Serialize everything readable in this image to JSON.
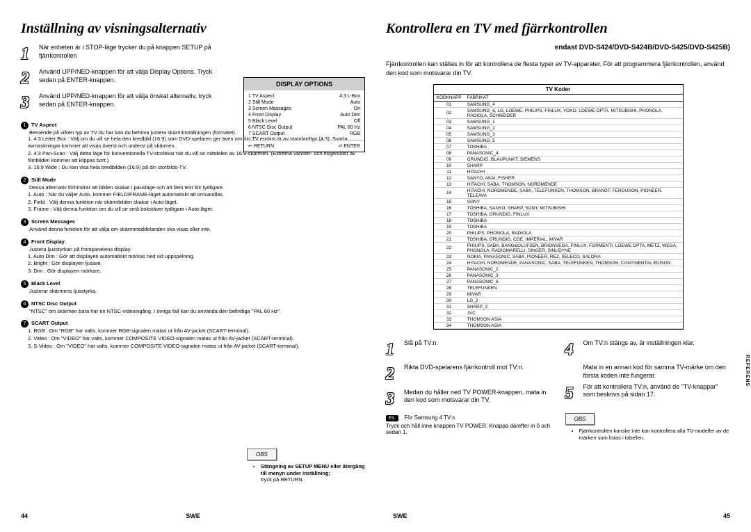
{
  "left": {
    "title": "Inställning av visningsalternativ",
    "steps": [
      {
        "n": "1",
        "text": "När enheten är i STOP-läge trycker du på knappen SETUP på fjärrkontrollen"
      },
      {
        "n": "2",
        "text": "Använd UPP/NED-knappen för att välja Display Options. Tryck sedan på ENTER-knappen."
      },
      {
        "n": "3",
        "text": "Använd UPP/NED-knappen för att välja önskat alternativ, tryck sedan på ENTER-knappen."
      }
    ],
    "panel": {
      "title": "DISPLAY OPTIONS",
      "rows": [
        {
          "l": "1 TV Aspect",
          "r": "4:3 L-Box"
        },
        {
          "l": "2 Still Mode",
          "r": "Auto"
        },
        {
          "l": "3 Screen Massages",
          "r": "On"
        },
        {
          "l": "4 Front Display",
          "r": "Auto Dim"
        },
        {
          "l": "5 Black Level",
          "r": "Off"
        },
        {
          "l": "6 NTSC Disc Output",
          "r": "PAL 60 Hz"
        },
        {
          "l": "7 SCART Output",
          "r": "RGB"
        }
      ],
      "return": "RETURN",
      "enter": "ENTER"
    },
    "details": [
      {
        "num": "1",
        "title": "TV Aspect",
        "desc": "Beroende på vilken typ av TV du har kan du behöva justera skärminställningen (formatet).",
        "items": [
          {
            "h": "1. 4:3 Letter Box :",
            "b": "Välj om du vill se hela den bredbild (16:9) som DVD-spelaren ger även om din TV endast är av standardtyp (4:3). Svarta avmaskningar kommer att visas överst och underst på skärmen."
          },
          {
            "h": "2. 4:3 Pan-Scan :",
            "b": "Välj detta läge för konventionella TV-storlekar när du vill se mittdelen av 16:9-skärmen. (Extrema vänster- och högersidor av filmbilden kommer att klippas bort.)"
          },
          {
            "h": "3. 16:9 Wide :",
            "b": "Du kan visa hela bredbilden (16:9) på din storbilds-TV."
          }
        ]
      },
      {
        "num": "2",
        "title": "Still Mode",
        "desc": "Dessa alternativ förhindrar att bilden skakar i pausläge och att liten text blir tydligare.",
        "items": [
          {
            "h": "1. Auto :",
            "b": "När du väljer Auto, kommer FIELD/FRAME-läget automatiskt att omvandlas."
          },
          {
            "h": "2. Field :",
            "b": "Välj denna funktion när skärmbilden skakar i Auto-läget."
          },
          {
            "h": "3. Frame :",
            "b": "Välj denna funktion om du vill se små bokstäver tydligare i Auto-läget."
          }
        ]
      },
      {
        "num": "3",
        "title": "Screen Messages",
        "desc": "Använd denna funktion för att välja om skärmmeddelanden ska visas eller inte."
      },
      {
        "num": "4",
        "title": "Front Display",
        "desc": "Justera ljusstyrkan på frontpanelens display.",
        "items": [
          {
            "h": "1. Auto Dim :",
            "b": "Gör att displayen automatiskt mörkas ned vid uppspelning."
          },
          {
            "h": "2. Bright :",
            "b": "Gör displayen ljusare."
          },
          {
            "h": "3. Dim :",
            "b": "Gör displayen mörkare."
          }
        ]
      },
      {
        "num": "5",
        "title": "Black Level",
        "desc": "Justerar skärmens ljusstyrka."
      },
      {
        "num": "6",
        "title": "NTSC Disc Output",
        "desc": "\"NTSC\" om skärmen bara har en NTSC-videoingång. I övriga fall kan du använda den befintliga \"PAL 60 Hz\"."
      },
      {
        "num": "7",
        "title": "SCART Output",
        "items": [
          {
            "h": "1. RGB :",
            "b": "Om \"RGB\" har valts, kommer RGB-signalen matas ut från AV-jacket (SCART-terminal)."
          },
          {
            "h": "2. Video :",
            "b": "Om \"VIDEO\" har valts, kommer COMPOSITE VIDEO-signalen matas ut från AV-jacket (SCART-terminal)."
          },
          {
            "h": "3. S-Video :",
            "b": "Om \"VIDEO\" har valts, kommer COMPOSITE VIDEO-signalen matas ut från AV-jacket (SCART-terminal)."
          }
        ]
      }
    ],
    "obs_label": "OBS",
    "obs": [
      "Stängning av SETUP MENU eller återgång till menyn under inställning;",
      "tryck på RETURN."
    ],
    "pagenum": "44",
    "swe": "SWE"
  },
  "right": {
    "title": "Kontrollera en TV med fjärrkontrollen",
    "subtitle": "endast DVD-S424/DVD-S424B/DVD-S425/DVD-S425B)",
    "intro": "Fjärrkontrollen kan ställas in för att kontrollera de flesta typer av TV-apparater. För att programmera fjärrkontrollen, använd den kod som motsvarar din TV.",
    "table_title": "TV Koder",
    "th1": "KODKNAPP",
    "th2": "FABRIKAT",
    "codes": [
      [
        "01",
        "SAMSUNG_4"
      ],
      [
        "02",
        "SAMSUNG_6, LG, LOEWE, PHILIPS, FINLUX, YOKO, LOEWE OPTA, MITSUBISHI, PHONOLA, RADIOLA, SCHNEIDER"
      ],
      [
        "03",
        "SAMSUNG_1"
      ],
      [
        "04",
        "SAMSUNG_2"
      ],
      [
        "05",
        "SAMSUNG_3"
      ],
      [
        "06",
        "SAMSUNG_5"
      ],
      [
        "07",
        "TOSHIBA"
      ],
      [
        "08",
        "PANASONIC_4"
      ],
      [
        "09",
        "GRUNDIG, BLAUPUNKT, SIEMENS"
      ],
      [
        "10",
        "SHARP"
      ],
      [
        "11",
        "HITACHI"
      ],
      [
        "12",
        "SANYO, AKAI, FISHER"
      ],
      [
        "13",
        "HITACHI, SABA, THOMSON, NORDMENDE"
      ],
      [
        "14",
        "HITACHI, NORDMENDE, SABA, TELEFUNKEN, THOMSON, BRANDT, FERGUSON, PIONEER, TELEAVA"
      ],
      [
        "15",
        "SONY"
      ],
      [
        "16",
        "TOSHIBA, SANYO, SHARP, SONY, MITSUBISHI"
      ],
      [
        "17",
        "TOSHIBA, GRUNDIG, FINLUX"
      ],
      [
        "18",
        "TOSHIBA"
      ],
      [
        "19",
        "TOSHIBA"
      ],
      [
        "20",
        "PHILIPS, PHONOLA, RADIOLA"
      ],
      [
        "21",
        "TOSHIBA, GRUNDIG, CGE, IMPERIAL, MIVAR"
      ],
      [
        "22",
        "PHILIPS, SABA, BANG&OLUFSEN, BRIONVEGA, FINLUX, FORMENTI, LOEWE OPTA, METZ, WEGA, PHONOLA, RADIOMARELLI, SINGER, SINUDYNE"
      ],
      [
        "23",
        "NOKIA, PANASONIC, SABA, PIONEER, REZ, SELECO, SALORA"
      ],
      [
        "24",
        "HITACHI, NORDMENDE, PANASONIC, SABA, TELEFUNKEN, THOMSON, CONTINENTAL EDISON"
      ],
      [
        "25",
        "PANASONIC_2"
      ],
      [
        "26",
        "PANASONIC_3"
      ],
      [
        "27",
        "PANASONIC_6"
      ],
      [
        "28",
        "TELEFUNKEN"
      ],
      [
        "29",
        "MIVAR"
      ],
      [
        "30",
        "LG_2"
      ],
      [
        "31",
        "SHARP_2"
      ],
      [
        "32",
        "JVC"
      ],
      [
        "33",
        "THOMSON ASIA"
      ],
      [
        "34",
        "THOMSON ASIA"
      ]
    ],
    "steps_left": [
      {
        "n": "1",
        "text": "Slå på TV:n."
      },
      {
        "n": "2",
        "text": "Rikta DVD-spelarens fjärrkontroll mot TV:n."
      },
      {
        "n": "3",
        "text": "Medan du håller ned TV POWER-knappen, mata in den kod som motsvarar din TV."
      }
    ],
    "steps_right": [
      {
        "n": "4",
        "text": "Om TV:n stängs av, är inställningen klar."
      },
      {
        "n": "5",
        "text": "Mata in en annan kod för samma TV-märke om den första koden inte fungerar."
      },
      {
        "n": "5b",
        "text": "För att kontrollera TV:n, använd de \"TV-knappar\" som beskrivs på sidan 17."
      }
    ],
    "ex_label": "Ex.",
    "ex_text": "För Samsung 4 TV:s",
    "ex_sub": "Tryck och håll inne knappen TV POWER. Knappa därefter in 0 och sedan 1.",
    "obs_label": "OBS",
    "obs": [
      "Fjärrkontrollen kanske inte kan kontrollera alla TV-modeller av de märken som listas i tabellen."
    ],
    "pagenum": "45",
    "swe": "SWE",
    "tab": "REFERENS"
  }
}
